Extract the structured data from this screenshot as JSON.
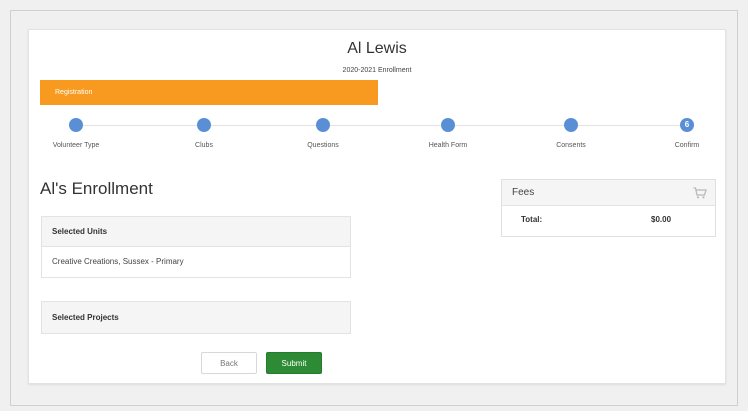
{
  "header": {
    "name": "Al Lewis",
    "subtitle": "2020-2021 Enrollment"
  },
  "progress": {
    "label": "Registration",
    "fraction": 0.5,
    "color": "#f79a1f"
  },
  "steps": [
    {
      "label": "Volunteer Type",
      "marker": ""
    },
    {
      "label": "Clubs",
      "marker": ""
    },
    {
      "label": "Questions",
      "marker": ""
    },
    {
      "label": "Health Form",
      "marker": ""
    },
    {
      "label": "Consents",
      "marker": ""
    },
    {
      "label": "Confirm",
      "marker": "6"
    }
  ],
  "main": {
    "title": "Al's Enrollment",
    "selected_units": {
      "heading": "Selected Units",
      "value": "Creative Creations, Sussex - Primary"
    },
    "selected_projects": {
      "heading": "Selected Projects"
    }
  },
  "buttons": {
    "back": "Back",
    "submit": "Submit",
    "submit_color": "#2e8b35"
  },
  "fees": {
    "title": "Fees",
    "icon": "cart-icon",
    "total_label": "Total:",
    "total_value": "$0.00"
  }
}
